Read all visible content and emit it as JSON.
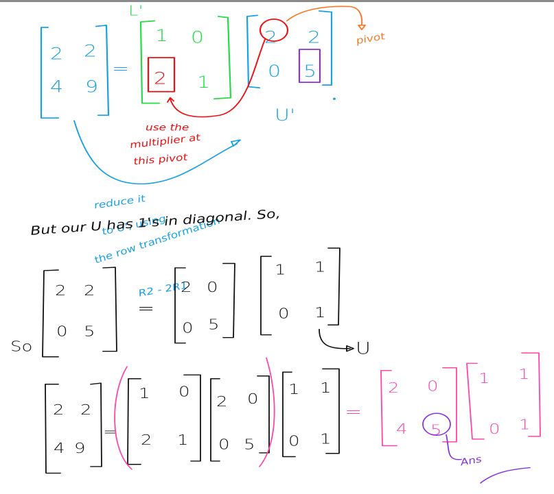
{
  "colors": {
    "blue": "#1ba1e2",
    "green": "#22dd44",
    "red": "#ee1111",
    "orange": "#ff7722",
    "purple": "#8833dd",
    "pink": "#ff44aa",
    "black": "#111111"
  },
  "top": {
    "A": [
      "2",
      "2",
      "4",
      "9"
    ],
    "equals": "=",
    "L_label": "L'",
    "L": [
      "1",
      "0",
      "2",
      "1"
    ],
    "U_prime": [
      "2",
      "2",
      "0",
      "5"
    ],
    "U_label": "U'",
    "pivot_label": "pivot",
    "red_note": [
      "use the",
      "multiplier at",
      "this pivot"
    ],
    "blue_note": [
      "reduce it",
      "to U', using",
      "the row transformation",
      "R2 - 2R1"
    ]
  },
  "bottom": {
    "statement": "But our U has 1's in diagonal. So,",
    "eq1": {
      "lhs": [
        "2",
        "2",
        "0",
        "5"
      ],
      "equals": "=",
      "D": [
        "2",
        "0",
        "0",
        "5"
      ],
      "U": [
        "1",
        "1",
        "0",
        "1"
      ],
      "U_label": "U"
    },
    "eq2": {
      "so": "So",
      "lhs": [
        "2",
        "2",
        "4",
        "9"
      ],
      "equals": "=",
      "L": [
        "1",
        "0",
        "2",
        "1"
      ],
      "D": [
        "2",
        "0",
        "0",
        "5"
      ],
      "U": [
        "1",
        "1",
        "0",
        "1"
      ],
      "equals2": "=",
      "LD": [
        "2",
        "0",
        "4",
        "5"
      ],
      "U2": [
        "1",
        "1",
        "0",
        "1"
      ],
      "ans": "Ans"
    }
  }
}
